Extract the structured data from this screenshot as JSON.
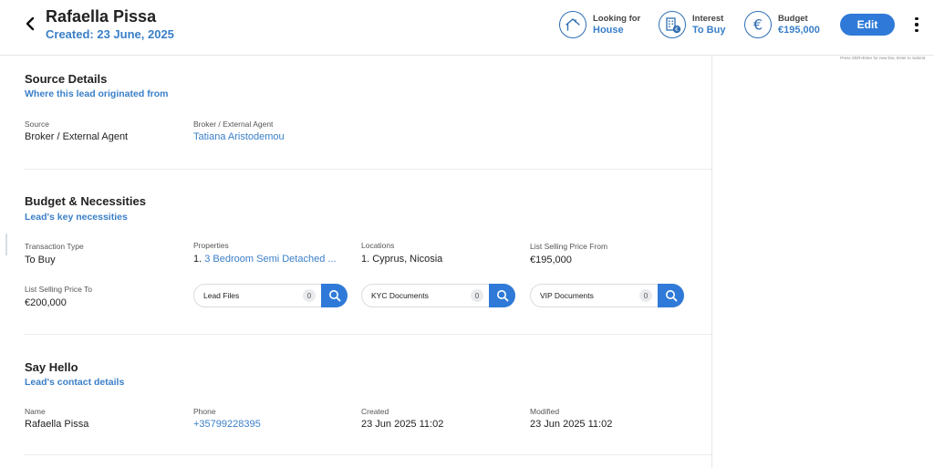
{
  "header": {
    "lead_name": "Rafaella Pissa",
    "created": "Created: 23 June, 2025",
    "looking_for": {
      "label": "Looking for",
      "value": "House"
    },
    "interest": {
      "label": "Interest",
      "value": "To Buy"
    },
    "budget": {
      "label": "Budget",
      "value": "€195,000"
    },
    "edit_label": "Edit"
  },
  "right_panel": {
    "hint": "Press Shift+Enter for new line, Enter to Submit"
  },
  "source": {
    "title": "Source Details",
    "subtitle": "Where this lead originated from",
    "source_label": "Source",
    "source_value": "Broker / External Agent",
    "broker_label": "Broker / External Agent",
    "broker_value": "Tatiana Aristodemou"
  },
  "budget_section": {
    "title": "Budget & Necessities",
    "subtitle": "Lead's key necessities",
    "transaction_type_label": "Transaction Type",
    "transaction_type_value": "To Buy",
    "properties_label": "Properties",
    "properties_num": "1.",
    "properties_value": "3 Bedroom Semi Detached ...",
    "locations_label": "Locations",
    "locations_value": "1. Cyprus, Nicosia",
    "price_from_label": "List Selling Price From",
    "price_from_value": "€195,000",
    "price_to_label": "List Selling Price To",
    "price_to_value": "€200,000",
    "docs": [
      {
        "label": "Lead Files",
        "count": "0"
      },
      {
        "label": "KYC Documents",
        "count": "0"
      },
      {
        "label": "VIP Documents",
        "count": "0"
      }
    ]
  },
  "contact": {
    "title": "Say Hello",
    "subtitle": "Lead's contact details",
    "name_label": "Name",
    "name_value": "Rafaella Pissa",
    "phone_label": "Phone",
    "phone_value": "+35799228395",
    "created_label": "Created",
    "created_value": "23 Jun 2025 11:02",
    "modified_label": "Modified",
    "modified_value": "23 Jun 2025 11:02"
  },
  "colors": {
    "accent": "#2f7ad8",
    "link": "#3a7fc8",
    "icon_stroke": "#2f6eb3"
  },
  "icons": [
    "back-arrow-icon",
    "house-icon",
    "building-euro-icon",
    "euro-icon",
    "more-vertical-icon",
    "search-icon"
  ]
}
